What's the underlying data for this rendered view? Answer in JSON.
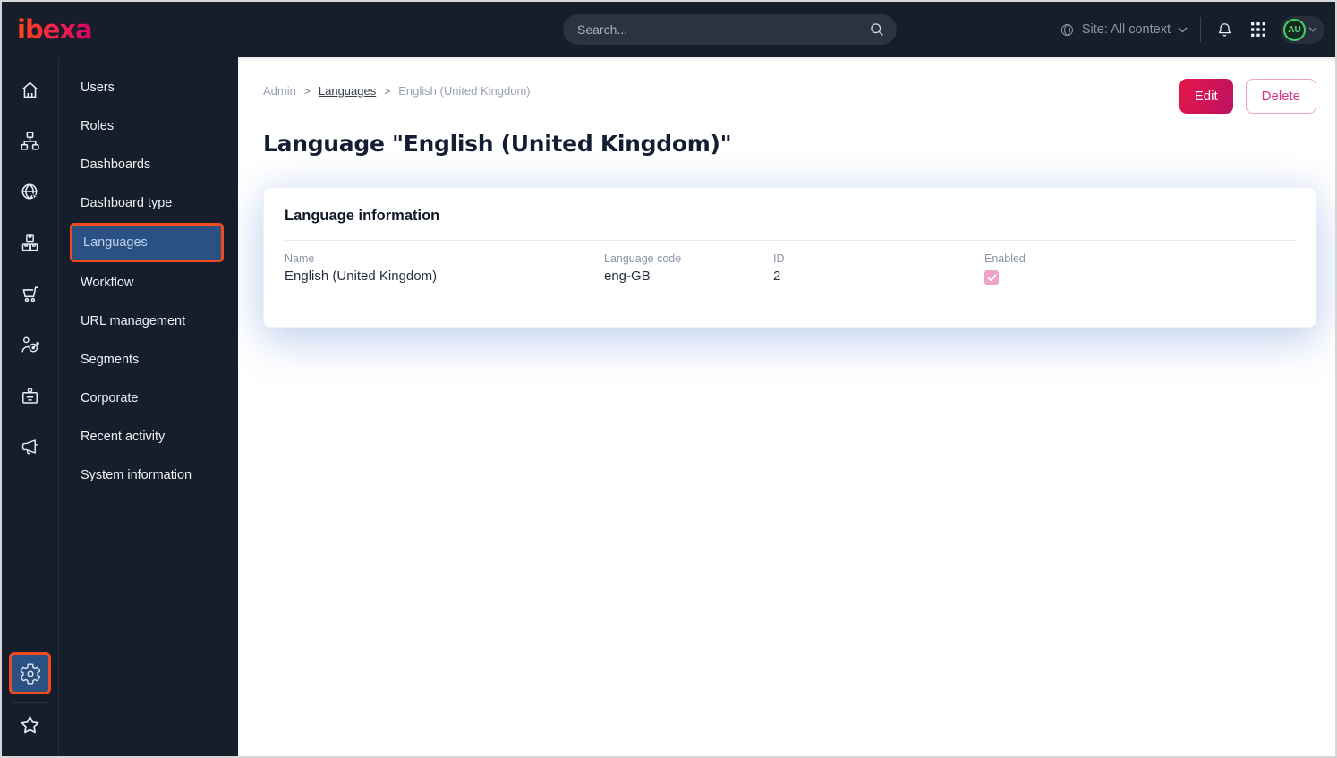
{
  "topbar": {
    "logo_text": "ibexa",
    "search_placeholder": "Search...",
    "site_context_label": "Site: All context",
    "avatar_initials": "AU"
  },
  "icon_rail": {
    "items": [
      "home",
      "content-tree",
      "site",
      "product-catalog",
      "commerce",
      "personalization",
      "corporate",
      "campaign"
    ],
    "bottom_items": [
      "settings",
      "bookmarks"
    ],
    "highlighted": "settings"
  },
  "sidebar": {
    "items": [
      {
        "label": "Users"
      },
      {
        "label": "Roles"
      },
      {
        "label": "Dashboards"
      },
      {
        "label": "Dashboard type"
      },
      {
        "label": "Languages",
        "active": true
      },
      {
        "label": "Workflow"
      },
      {
        "label": "URL management"
      },
      {
        "label": "Segments"
      },
      {
        "label": "Corporate"
      },
      {
        "label": "Recent activity"
      },
      {
        "label": "System information"
      }
    ]
  },
  "breadcrumb": {
    "items": [
      "Admin",
      "Languages",
      "English (United Kingdom)"
    ],
    "separator": ">"
  },
  "actions": {
    "edit_label": "Edit",
    "delete_label": "Delete"
  },
  "page": {
    "title": "Language \"English (United Kingdom)\""
  },
  "card": {
    "heading": "Language information",
    "fields": [
      {
        "label": "Name",
        "value": "English (United Kingdom)"
      },
      {
        "label": "Language code",
        "value": "eng-GB"
      },
      {
        "label": "ID",
        "value": "2"
      },
      {
        "label": "Enabled",
        "value": "checked",
        "type": "checkbox"
      }
    ]
  },
  "colors": {
    "topbar_bg": "#161e2b",
    "highlight_orange": "#ee4c1e",
    "selected_blue": "#2a5181",
    "primary_gradient": [
      "#e5174a",
      "#bc1162"
    ],
    "checkbox_pink": "#efa3c7",
    "avatar_green": "#45cf6b"
  }
}
